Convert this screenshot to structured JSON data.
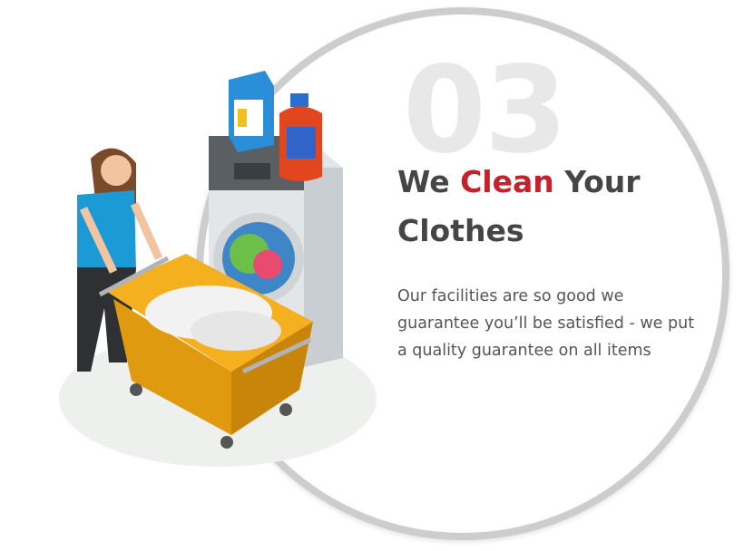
{
  "step_number": "03",
  "headline": {
    "part1": "We ",
    "accent": "Clean",
    "part2": " Your Clothes"
  },
  "description": "Our facilities are so good we guarantee you’ll be satisfied - we put a quality guarantee on all items",
  "colors": {
    "accent": "#c4212a",
    "heading": "#454545",
    "ring": "#cdcdcd",
    "number": "#e8e8e8"
  },
  "illustration": "woman-pushing-laundry-cart-beside-washing-machine"
}
